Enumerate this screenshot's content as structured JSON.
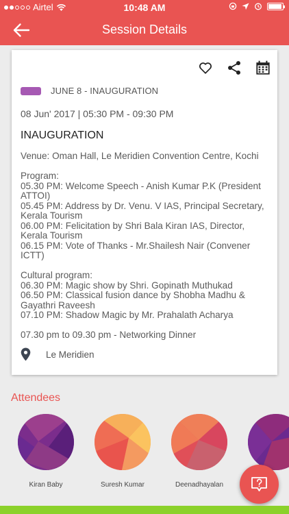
{
  "status_bar": {
    "carrier": "Airtel",
    "time": "10:48 AM"
  },
  "nav": {
    "title": "Session Details"
  },
  "session": {
    "track_label": "JUNE 8 - INAUGURATION",
    "track_color": "#a659b3",
    "time": "08 Jun' 2017 | 05:30 PM - 09:30 PM",
    "title": "INAUGURATION",
    "description_lines": [
      "Venue: Oman Hall, Le Meridien Convention Centre, Kochi",
      "",
      "Program:",
      "05.30 PM: Welcome Speech - Anish Kumar P.K (President",
      "ATTOI)",
      "05.45 PM: Address by Dr. Venu. V IAS, Principal Secretary,",
      "Kerala Tourism",
      "06.00 PM: Felicitation by Shri Bala Kiran IAS, Director,",
      "Kerala Tourism",
      "06.15 PM: Vote of Thanks - Mr.Shailesh Nair (Convener",
      "ICTT)",
      "",
      "Cultural program:",
      "06.30 PM: Magic show by Shri. Gopinath Muthukad",
      "06.50 PM: Classical fusion dance by Shobha Madhu &",
      "Gayathri Raveesh",
      "07.10 PM: Shadow Magic by Mr. Prahalath Acharya",
      "",
      "07.30 pm to 09.30 pm - Networking Dinner"
    ],
    "location": "Le Meridien"
  },
  "attendees": {
    "title": "Attendees",
    "items": [
      {
        "name": "Kiran Baby"
      },
      {
        "name": "Suresh Kumar"
      },
      {
        "name": "Deenadhayalan"
      },
      {
        "name": ""
      }
    ]
  },
  "colors": {
    "brand": "#e95452",
    "bottom_bar": "#8bd12b"
  },
  "icons": {
    "back": "arrow-left-icon",
    "favorite": "heart-icon",
    "share": "share-icon",
    "calendar": "calendar-icon",
    "location": "map-pin-icon",
    "help": "question-bubble-icon"
  }
}
